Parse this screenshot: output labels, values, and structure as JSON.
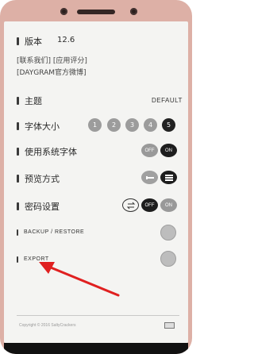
{
  "app": {
    "version_label": "版本",
    "version_value": "12.6",
    "links": "[联系我们] [应用评分]",
    "weibo": "[DAYGRAM官方微博]"
  },
  "theme": {
    "label": "主题",
    "value": "DEFAULT"
  },
  "font_size": {
    "label": "字体大小",
    "options": [
      "1",
      "2",
      "3",
      "4",
      "5"
    ],
    "selected": "5"
  },
  "system_font": {
    "label": "使用系统字体",
    "off": "OFF",
    "on": "ON"
  },
  "preview": {
    "label": "预览方式"
  },
  "password": {
    "label": "密码设置",
    "off": "OFF",
    "on": "ON"
  },
  "backup": {
    "label": "BACKUP / RESTORE"
  },
  "export": {
    "label": "EXPORT"
  },
  "footer": {
    "copyright": "Copyright © 2016 SaltyCrackers"
  },
  "colors": {
    "phone_body": "#ddb0a6",
    "screen_bg": "#f4f4f2",
    "arrow": "#e02020"
  }
}
